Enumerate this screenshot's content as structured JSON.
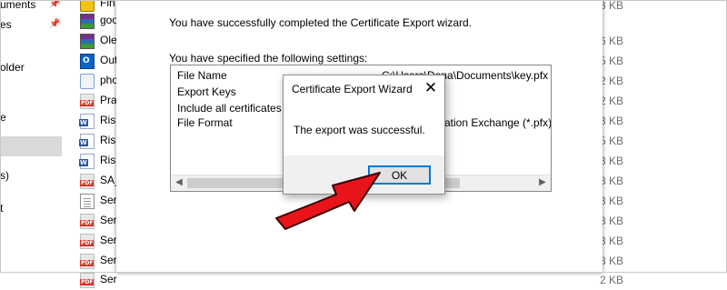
{
  "nav": {
    "items": [
      {
        "label": "uments",
        "pinned": true,
        "selected": false
      },
      {
        "label": "es",
        "pinned": true,
        "selected": false
      },
      {
        "label": "",
        "pinned": false,
        "selected": false
      },
      {
        "label": "older",
        "pinned": false,
        "selected": false
      },
      {
        "label": "",
        "pinned": false,
        "selected": false
      },
      {
        "label": "e",
        "pinned": false,
        "selected": false
      },
      {
        "label": "",
        "pinned": false,
        "selected": true
      },
      {
        "label": "",
        "pinned": false,
        "selected": false
      },
      {
        "label": "s)",
        "pinned": false,
        "selected": false
      },
      {
        "label": "",
        "pinned": false,
        "selected": false
      },
      {
        "label": "t",
        "pinned": false,
        "selected": false
      }
    ]
  },
  "files": [
    {
      "name": "Fin",
      "icon": "app-icon"
    },
    {
      "name": "goo",
      "icon": "winrar-icon"
    },
    {
      "name": "Ole",
      "icon": "winrar-icon"
    },
    {
      "name": "Out",
      "icon": "outlook-icon"
    },
    {
      "name": "pho",
      "icon": "photo-icon"
    },
    {
      "name": "Pra",
      "icon": "pdf-icon"
    },
    {
      "name": "Risk",
      "icon": "word-icon"
    },
    {
      "name": "Risk",
      "icon": "word-icon"
    },
    {
      "name": "Risk",
      "icon": "word-icon"
    },
    {
      "name": "SA_",
      "icon": "pdf-icon"
    },
    {
      "name": "Ser",
      "icon": "document-icon"
    },
    {
      "name": "Ser",
      "icon": "pdf-icon"
    },
    {
      "name": "Ser",
      "icon": "pdf-icon"
    },
    {
      "name": "Ser",
      "icon": "pdf-icon"
    },
    {
      "name": "Ser",
      "icon": "pdf-icon"
    }
  ],
  "sizes": [
    "3 KB",
    "6 KB",
    "5 KB",
    "2 KB",
    "2 KB",
    "3 KB",
    "5 KB",
    "3 KB",
    "3 KB",
    "3 KB",
    "3 KB",
    "3 KB",
    "8 KB",
    "2 KB"
  ],
  "wizard": {
    "completed_message": "You have successfully completed the Certificate Export wizard.",
    "settings_label": "You have specified the following settings:",
    "settings": [
      {
        "name": "File Name",
        "value": "C:\\Users\\Dona\\Documents\\key.pfx"
      },
      {
        "name": "Export Keys",
        "value": ""
      },
      {
        "name": "Include all certificates in",
        "value": ""
      },
      {
        "name": "File Format",
        "value": "mation Exchange (*.pfx)"
      }
    ]
  },
  "dialog": {
    "title": "Certificate Export Wizard",
    "close_glyph": "✕",
    "message": "The export was successful.",
    "ok_label": "OK"
  },
  "annotation": {
    "arrow_color": "#e8141a",
    "arrow_outline": "#3a0000"
  },
  "icons": {
    "pdf_badge": "PDF",
    "word_badge": "W",
    "outlook_badge": "O"
  }
}
